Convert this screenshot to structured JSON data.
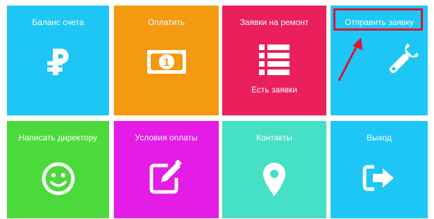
{
  "tiles": [
    {
      "label": "Баланс счета",
      "icon": "ruble-icon",
      "color": "#1ec6f6"
    },
    {
      "label": "Оплатить",
      "icon": "banknote-icon",
      "color": "#f39a11"
    },
    {
      "label": "Заявки на ремонт",
      "icon": "list-icon",
      "color": "#ea1f5b",
      "sub": "Есть заявки"
    },
    {
      "label": "Отправить заявку",
      "icon": "wrench-icon",
      "color": "#1ec6f6"
    },
    {
      "label": "Написать директору",
      "icon": "smiley-icon",
      "color": "#4cd93b"
    },
    {
      "label": "Условия оплаты",
      "icon": "edit-icon",
      "color": "#e51be6"
    },
    {
      "label": "Контакты",
      "icon": "map-pin-icon",
      "color": "#46e0c6"
    },
    {
      "label": "Выход",
      "icon": "exit-icon",
      "color": "#1ec6f6"
    }
  ],
  "annotation": {
    "highlight_color": "#e0112d",
    "arrow": "pointer-arrow"
  }
}
